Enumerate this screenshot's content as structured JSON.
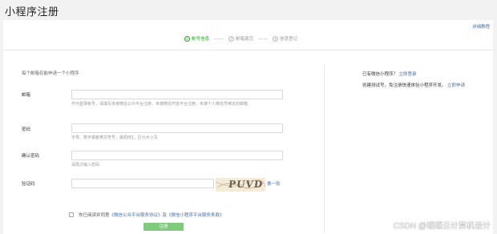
{
  "page": {
    "title": "小程序注册"
  },
  "header": {
    "help_link": "详细教程"
  },
  "steps": [
    {
      "num": "①",
      "label": "帐号信息"
    },
    {
      "num": "②",
      "label": "邮箱激活"
    },
    {
      "num": "③",
      "label": "信息登记"
    }
  ],
  "form": {
    "intro": "每个邮箱仅能申请一个小程序",
    "email": {
      "label": "邮箱",
      "value": "",
      "placeholder": "",
      "hint": "作为登录帐号，请填写未被微信公众平台注册，未被微信开放平台注册，未被个人微信号绑定的邮箱"
    },
    "password": {
      "label": "密码",
      "value": "",
      "placeholder": "",
      "hint": "字母、数字或者英文符号，最短8位，区分大小写"
    },
    "confirm": {
      "label": "确认密码",
      "value": "",
      "placeholder": "",
      "hint": "请再次输入密码"
    },
    "captcha": {
      "label": "验证码",
      "value": "",
      "placeholder": "",
      "image_text": "PUVD",
      "refresh": "换一张"
    },
    "agree": {
      "prefix": "你已阅读并同意",
      "link1": "《微信公众平台服务协议》",
      "and": "及",
      "link2": "《微信小程序平台服务条款》"
    },
    "submit": "注册"
  },
  "sidebar": {
    "question": "已有微信小程序？",
    "login_link": "立即登录",
    "desc": "创建测试号，免注册快速体验小程序开发。",
    "apply_link": "立即申请"
  },
  "watermark": "CSDN @韬韬云计算机设计"
}
